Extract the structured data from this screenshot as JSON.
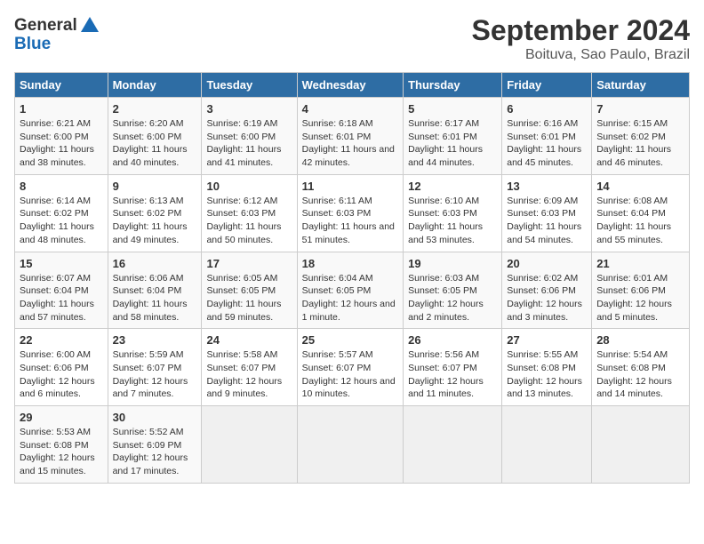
{
  "header": {
    "logo_line1": "General",
    "logo_line2": "Blue",
    "month_year": "September 2024",
    "location": "Boituva, Sao Paulo, Brazil"
  },
  "weekdays": [
    "Sunday",
    "Monday",
    "Tuesday",
    "Wednesday",
    "Thursday",
    "Friday",
    "Saturday"
  ],
  "weeks": [
    [
      {
        "day": "1",
        "sunrise": "6:21 AM",
        "sunset": "6:00 PM",
        "daylight": "11 hours and 38 minutes."
      },
      {
        "day": "2",
        "sunrise": "6:20 AM",
        "sunset": "6:00 PM",
        "daylight": "11 hours and 40 minutes."
      },
      {
        "day": "3",
        "sunrise": "6:19 AM",
        "sunset": "6:00 PM",
        "daylight": "11 hours and 41 minutes."
      },
      {
        "day": "4",
        "sunrise": "6:18 AM",
        "sunset": "6:01 PM",
        "daylight": "11 hours and 42 minutes."
      },
      {
        "day": "5",
        "sunrise": "6:17 AM",
        "sunset": "6:01 PM",
        "daylight": "11 hours and 44 minutes."
      },
      {
        "day": "6",
        "sunrise": "6:16 AM",
        "sunset": "6:01 PM",
        "daylight": "11 hours and 45 minutes."
      },
      {
        "day": "7",
        "sunrise": "6:15 AM",
        "sunset": "6:02 PM",
        "daylight": "11 hours and 46 minutes."
      }
    ],
    [
      {
        "day": "8",
        "sunrise": "6:14 AM",
        "sunset": "6:02 PM",
        "daylight": "11 hours and 48 minutes."
      },
      {
        "day": "9",
        "sunrise": "6:13 AM",
        "sunset": "6:02 PM",
        "daylight": "11 hours and 49 minutes."
      },
      {
        "day": "10",
        "sunrise": "6:12 AM",
        "sunset": "6:03 PM",
        "daylight": "11 hours and 50 minutes."
      },
      {
        "day": "11",
        "sunrise": "6:11 AM",
        "sunset": "6:03 PM",
        "daylight": "11 hours and 51 minutes."
      },
      {
        "day": "12",
        "sunrise": "6:10 AM",
        "sunset": "6:03 PM",
        "daylight": "11 hours and 53 minutes."
      },
      {
        "day": "13",
        "sunrise": "6:09 AM",
        "sunset": "6:03 PM",
        "daylight": "11 hours and 54 minutes."
      },
      {
        "day": "14",
        "sunrise": "6:08 AM",
        "sunset": "6:04 PM",
        "daylight": "11 hours and 55 minutes."
      }
    ],
    [
      {
        "day": "15",
        "sunrise": "6:07 AM",
        "sunset": "6:04 PM",
        "daylight": "11 hours and 57 minutes."
      },
      {
        "day": "16",
        "sunrise": "6:06 AM",
        "sunset": "6:04 PM",
        "daylight": "11 hours and 58 minutes."
      },
      {
        "day": "17",
        "sunrise": "6:05 AM",
        "sunset": "6:05 PM",
        "daylight": "11 hours and 59 minutes."
      },
      {
        "day": "18",
        "sunrise": "6:04 AM",
        "sunset": "6:05 PM",
        "daylight": "12 hours and 1 minute."
      },
      {
        "day": "19",
        "sunrise": "6:03 AM",
        "sunset": "6:05 PM",
        "daylight": "12 hours and 2 minutes."
      },
      {
        "day": "20",
        "sunrise": "6:02 AM",
        "sunset": "6:06 PM",
        "daylight": "12 hours and 3 minutes."
      },
      {
        "day": "21",
        "sunrise": "6:01 AM",
        "sunset": "6:06 PM",
        "daylight": "12 hours and 5 minutes."
      }
    ],
    [
      {
        "day": "22",
        "sunrise": "6:00 AM",
        "sunset": "6:06 PM",
        "daylight": "12 hours and 6 minutes."
      },
      {
        "day": "23",
        "sunrise": "5:59 AM",
        "sunset": "6:07 PM",
        "daylight": "12 hours and 7 minutes."
      },
      {
        "day": "24",
        "sunrise": "5:58 AM",
        "sunset": "6:07 PM",
        "daylight": "12 hours and 9 minutes."
      },
      {
        "day": "25",
        "sunrise": "5:57 AM",
        "sunset": "6:07 PM",
        "daylight": "12 hours and 10 minutes."
      },
      {
        "day": "26",
        "sunrise": "5:56 AM",
        "sunset": "6:07 PM",
        "daylight": "12 hours and 11 minutes."
      },
      {
        "day": "27",
        "sunrise": "5:55 AM",
        "sunset": "6:08 PM",
        "daylight": "12 hours and 13 minutes."
      },
      {
        "day": "28",
        "sunrise": "5:54 AM",
        "sunset": "6:08 PM",
        "daylight": "12 hours and 14 minutes."
      }
    ],
    [
      {
        "day": "29",
        "sunrise": "5:53 AM",
        "sunset": "6:08 PM",
        "daylight": "12 hours and 15 minutes."
      },
      {
        "day": "30",
        "sunrise": "5:52 AM",
        "sunset": "6:09 PM",
        "daylight": "12 hours and 17 minutes."
      },
      null,
      null,
      null,
      null,
      null
    ]
  ]
}
